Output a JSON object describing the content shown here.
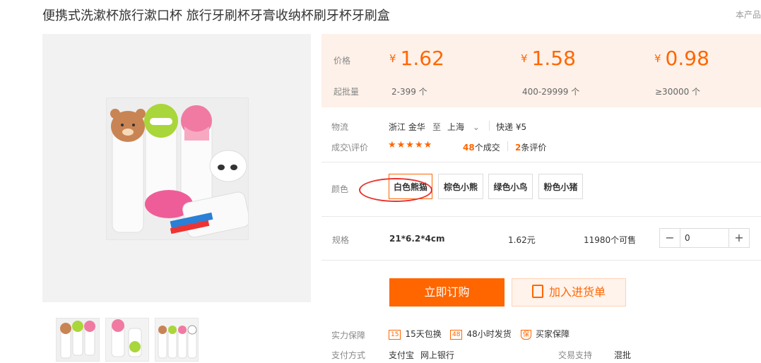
{
  "product": {
    "title": "便携式洗漱杯旅行漱口杯 旅行牙刷杯牙膏收纳杯刷牙杯牙刷盒",
    "corner_text": "本产品"
  },
  "pricing": {
    "price_label": "价格",
    "moq_label": "起批量",
    "currency": "¥",
    "tiers": [
      {
        "price": "1.62",
        "range": "2-399 个"
      },
      {
        "price": "1.58",
        "range": "400-29999 个"
      },
      {
        "price": "0.98",
        "range": "≥30000 个"
      }
    ]
  },
  "logistics": {
    "label": "物流",
    "origin": "浙江 金华",
    "to": "至",
    "destination": "上海",
    "express": "快递 ¥5"
  },
  "deals": {
    "label": "成交\\评价",
    "stars": "★★★★★",
    "deal_count": "48",
    "deal_suffix": "个成交",
    "review_count": "2",
    "review_suffix": "条评价"
  },
  "color": {
    "label": "颜色",
    "options": [
      "白色熊猫",
      "棕色小熊",
      "绿色小鸟",
      "粉色小猪"
    ],
    "selected_index": 0
  },
  "spec": {
    "label": "规格",
    "size": "21*6.2*4cm",
    "price": "1.62元",
    "stock": "11980个可售",
    "quantity": "0",
    "minus": "−",
    "plus": "+"
  },
  "actions": {
    "buy": "立即订购",
    "cart": "加入进货单"
  },
  "guarantee": {
    "label": "实力保障",
    "items": [
      {
        "icon": "15",
        "text": "15天包换"
      },
      {
        "icon": "48",
        "text": "48小时发货"
      },
      {
        "icon": "保",
        "text": "买家保障"
      }
    ]
  },
  "payment": {
    "label": "支付方式",
    "methods": [
      "支付宝",
      "网上银行"
    ],
    "trade_label": "交易支持",
    "trade_value": "混批"
  },
  "colors": {
    "accent": "#ff6600",
    "price_bg": "#fef1e9",
    "circle": "#e8322d"
  }
}
